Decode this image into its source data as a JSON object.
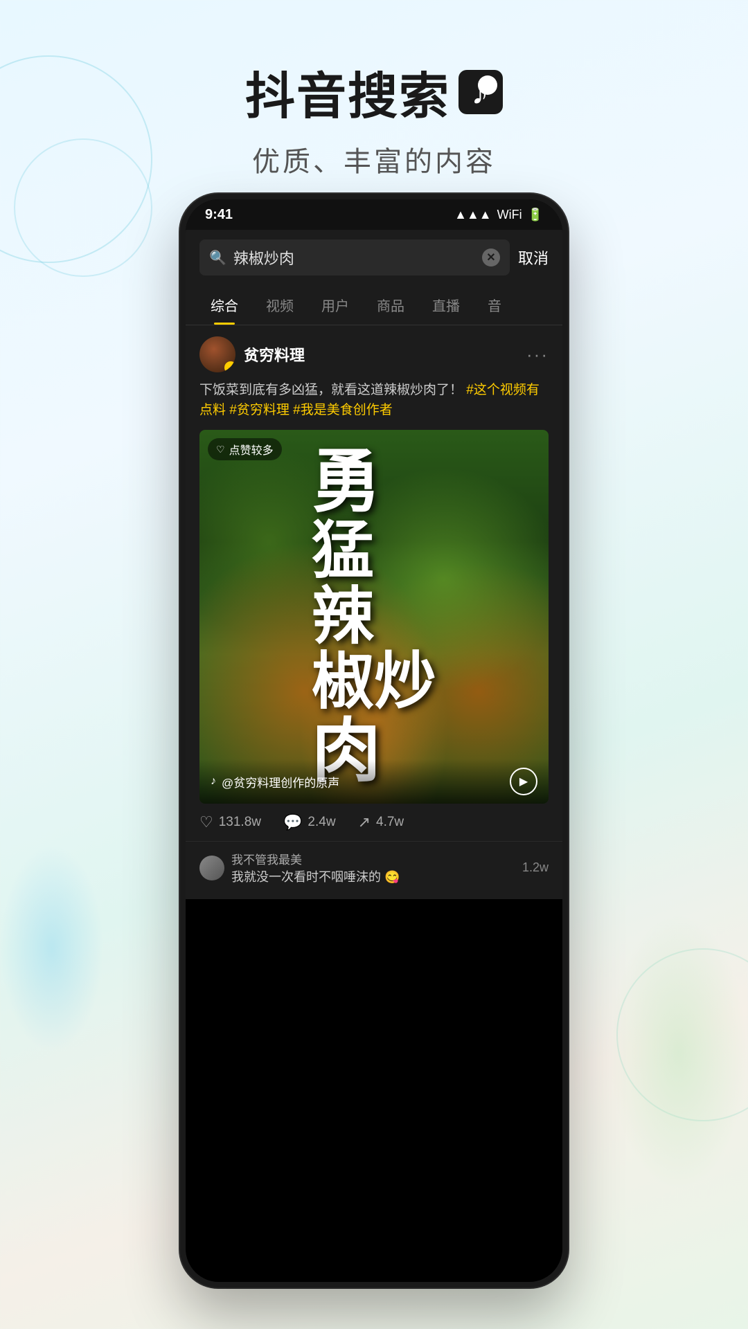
{
  "header": {
    "title": "抖音搜索",
    "logo_symbol": "♪",
    "subtitle": "优质、丰富的内容"
  },
  "phone": {
    "status_bar": {
      "time": "9:41",
      "battery": "▮▮▮",
      "signal": "◀◀"
    },
    "search": {
      "placeholder": "辣椒炒肉",
      "cancel_label": "取消"
    },
    "tabs": [
      {
        "label": "综合",
        "active": true
      },
      {
        "label": "视频",
        "active": false
      },
      {
        "label": "用户",
        "active": false
      },
      {
        "label": "商品",
        "active": false
      },
      {
        "label": "直播",
        "active": false
      },
      {
        "label": "音",
        "active": false
      }
    ],
    "post": {
      "username": "贫穷料理",
      "description": "下饭菜到底有多凶猛，就看这道辣椒炒肉了！",
      "hashtags": [
        "#这个视频有点料",
        "#贫穷料理",
        "#我是美食创作者"
      ],
      "video": {
        "overlay_text": "勇猛辣椒炒肉",
        "likes_badge": "点赞较多",
        "audio": "@贫穷料理创作的原声"
      },
      "engagement": {
        "likes": "131.8w",
        "comments": "2.4w",
        "shares": "4.7w"
      },
      "comments": [
        {
          "user": "我不管我最美",
          "text": "我就没一次看时不咽唾沫的 😋"
        }
      ],
      "comment_count": "1.2w"
    }
  }
}
